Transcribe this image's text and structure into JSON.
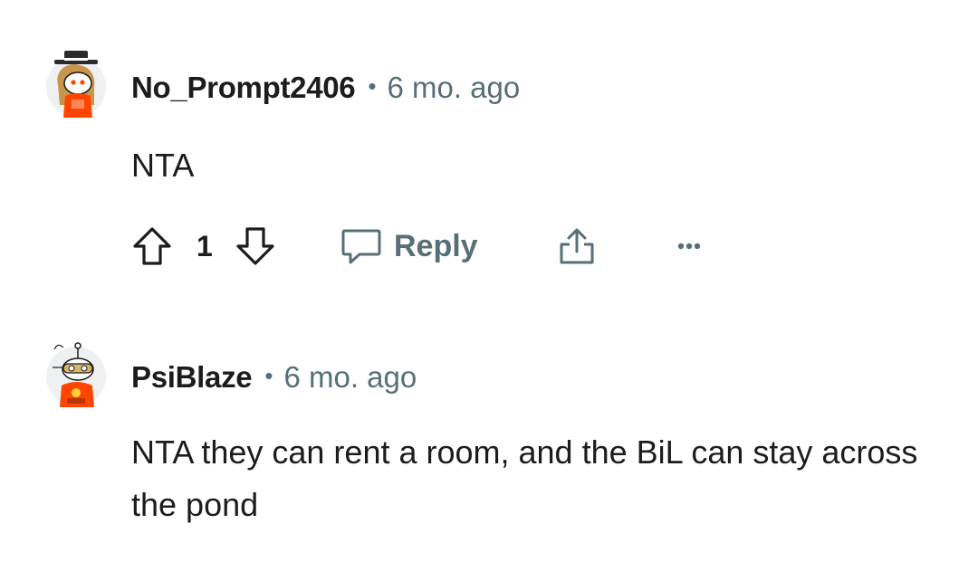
{
  "comments": [
    {
      "username": "No_Prompt2406",
      "separator": "•",
      "time": "6 mo. ago",
      "body": "NTA",
      "avatar_icon": "snoo-avatar-top-hat-icon",
      "votes": "1",
      "reply_label": "Reply"
    },
    {
      "username": "PsiBlaze",
      "separator": "•",
      "time": "6 mo. ago",
      "body": "NTA they can rent a room, and the BiL can stay across the pond",
      "avatar_icon": "snoo-avatar-goggles-icon"
    }
  ],
  "icons": {
    "upvote": "arrow-up-icon",
    "downvote": "arrow-down-icon",
    "reply": "speech-bubble-icon",
    "share": "share-icon",
    "more": "more-options-icon"
  },
  "colors": {
    "text": "#1c1c1c",
    "meta": "#576f76",
    "avatar_orange": "#ff4500"
  }
}
